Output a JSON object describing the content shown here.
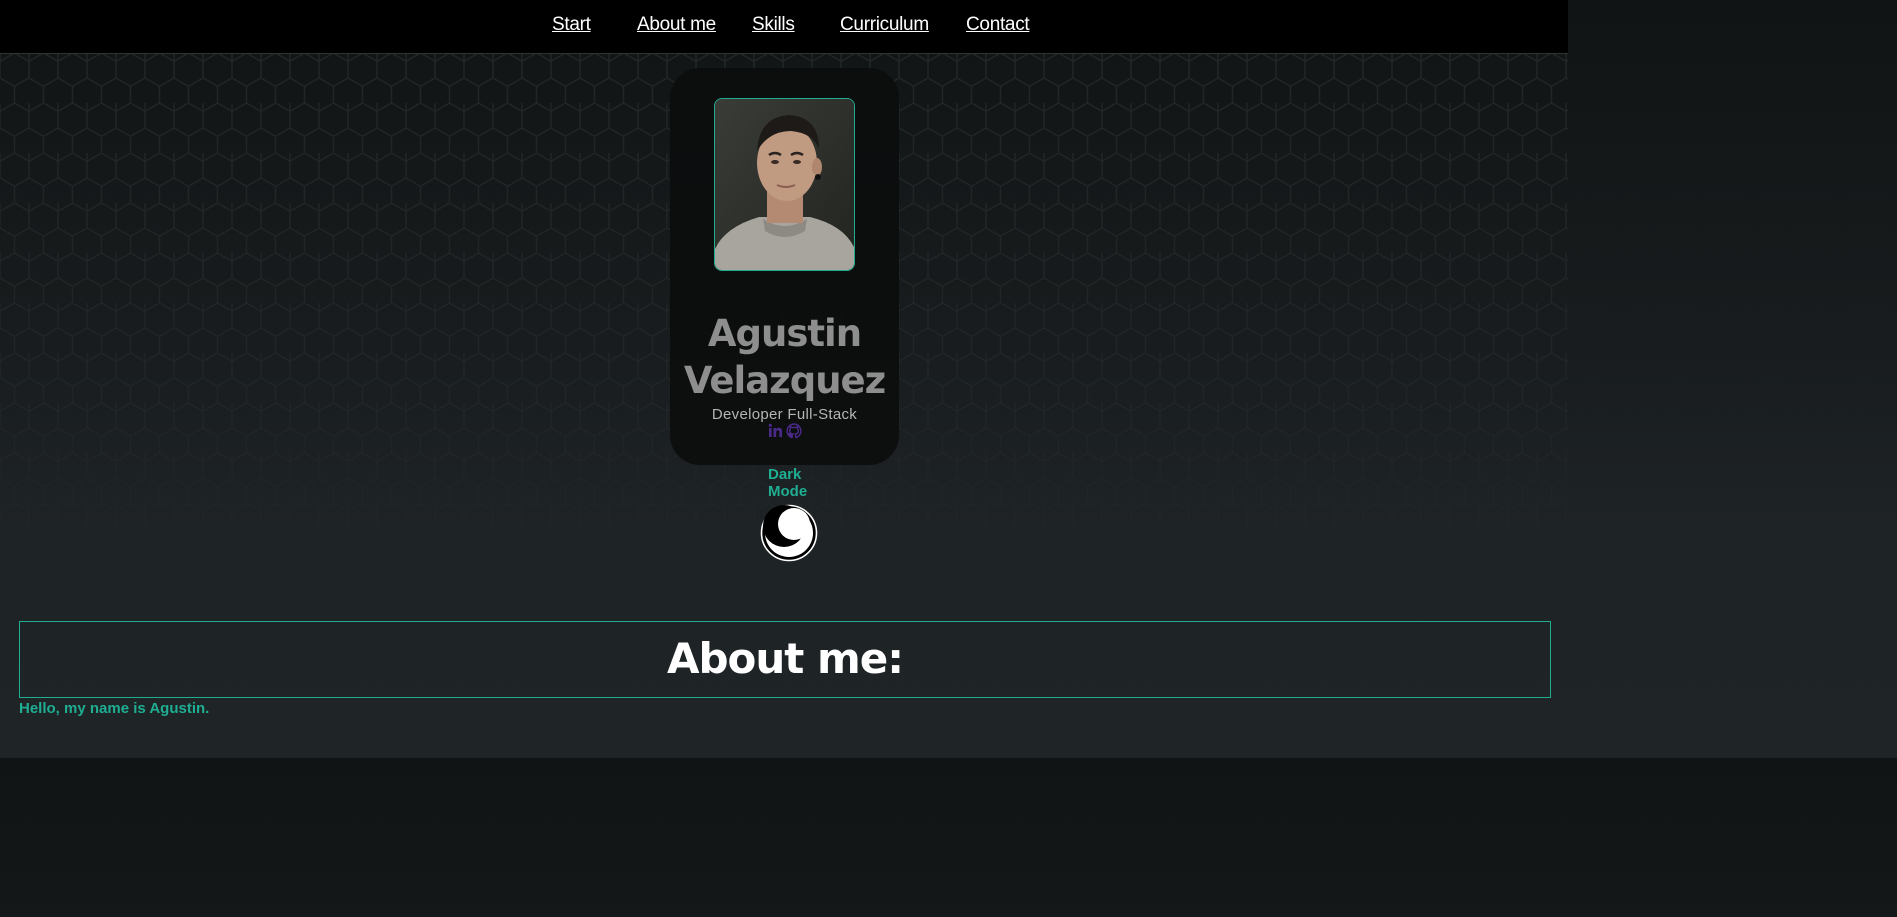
{
  "nav": {
    "items": [
      "Start",
      "About me",
      "Skills",
      "Curriculum",
      "Contact"
    ]
  },
  "profile": {
    "name_line1": "Agustin",
    "name_line2": "Velazquez",
    "role": "Developer Full-Stack",
    "social_icons": [
      "linkedin-icon",
      "github-icon"
    ]
  },
  "theme": {
    "toggle_label_line1": "Dark",
    "toggle_label_line2": "Mode",
    "toggle_icon": "moon-icon"
  },
  "about": {
    "title": "About me:",
    "intro": "Hello, my name is Agustin."
  },
  "colors": {
    "accent": "#1fae91",
    "nav_bg": "#000000",
    "name_text": "#8e8e8e",
    "social_icon": "#4b2a8a"
  }
}
